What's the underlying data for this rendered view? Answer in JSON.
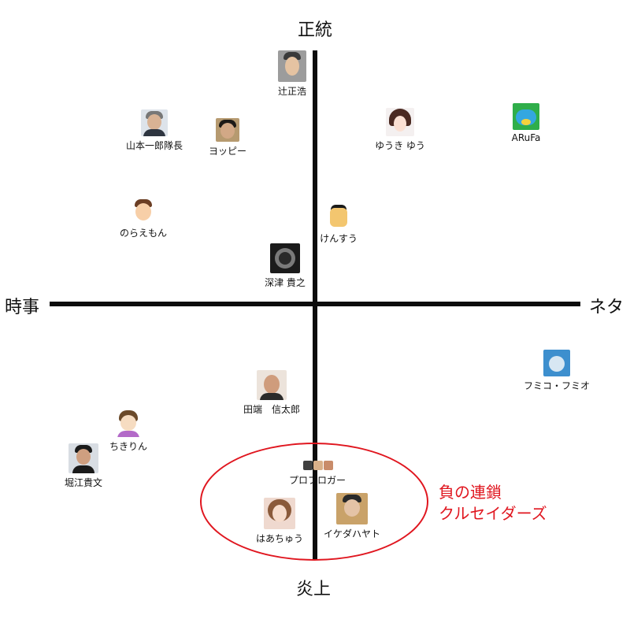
{
  "axes": {
    "top": "正統",
    "bottom": "炎上",
    "left": "時事",
    "right": "ネタ"
  },
  "people": [
    {
      "id": "tsuji",
      "name": "辻正浩",
      "icon": "man-portrait-icon"
    },
    {
      "id": "yamamoto",
      "name": "山本一郎隊長",
      "icon": "man-portrait-icon"
    },
    {
      "id": "yoppy",
      "name": "ヨッピー",
      "icon": "man-portrait-icon"
    },
    {
      "id": "yuuki",
      "name": "ゆうき ゆう",
      "icon": "anime-girl-icon"
    },
    {
      "id": "arufa",
      "name": "ARuFa",
      "icon": "mascot-icon"
    },
    {
      "id": "norae",
      "name": "のらえもん",
      "icon": "cartoon-face-icon"
    },
    {
      "id": "kensuu",
      "name": "けんすう",
      "icon": "cartoon-face-icon"
    },
    {
      "id": "fukatsu",
      "name": "深津 貴之",
      "icon": "camera-lens-icon"
    },
    {
      "id": "fumiko",
      "name": "フミコ・フミオ",
      "icon": "mascot-icon"
    },
    {
      "id": "tabata",
      "name": "田端　信太郎",
      "icon": "man-portrait-icon"
    },
    {
      "id": "chikirin",
      "name": "ちきりん",
      "icon": "cartoon-face-icon"
    },
    {
      "id": "horie",
      "name": "堀江貴文",
      "icon": "man-portrait-icon"
    },
    {
      "id": "problogger",
      "name": "プロブロガー",
      "icon": "group-portrait-icon"
    },
    {
      "id": "haachu",
      "name": "はあちゅう",
      "icon": "woman-portrait-icon"
    },
    {
      "id": "ikeda",
      "name": "イケダハヤト",
      "icon": "man-portrait-icon"
    }
  ],
  "annotation": {
    "line1": "負の連鎖",
    "line2": "クルセイダーズ"
  },
  "colors": {
    "axis": "#0c0c0c",
    "annotation": "#e0161f"
  }
}
